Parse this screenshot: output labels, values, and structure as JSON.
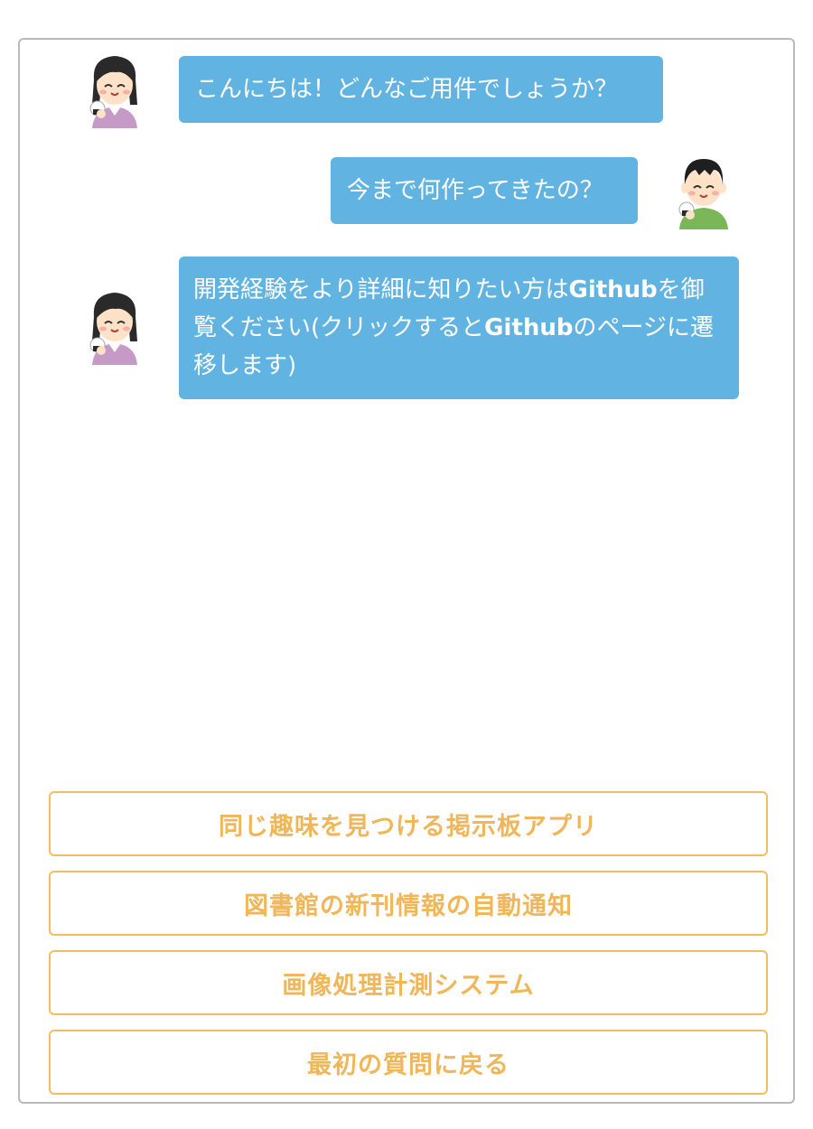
{
  "messages": [
    {
      "speaker": "bot",
      "text": "こんにちは！どんなご用件でしょうか？"
    },
    {
      "speaker": "user",
      "text": "今まで何作ってきたの？"
    },
    {
      "speaker": "bot",
      "parts": [
        "開発経験をより詳細に知りたい方は",
        "Github",
        "を御覧ください(クリックすると",
        "Github",
        "のページに遷移します)"
      ]
    }
  ],
  "avatars": {
    "bot": "woman-avatar-icon",
    "user": "man-avatar-icon"
  },
  "choices": [
    "同じ趣味を見つける掲示板アプリ",
    "図書館の新刊情報の自動通知",
    "画像処理計測システム",
    "最初の質問に戻る"
  ],
  "colors": {
    "bubble": "#61b4e1",
    "choice_border": "#f3bd64",
    "choice_text": "#f0b65a",
    "frame_border": "#b9b9b9"
  }
}
